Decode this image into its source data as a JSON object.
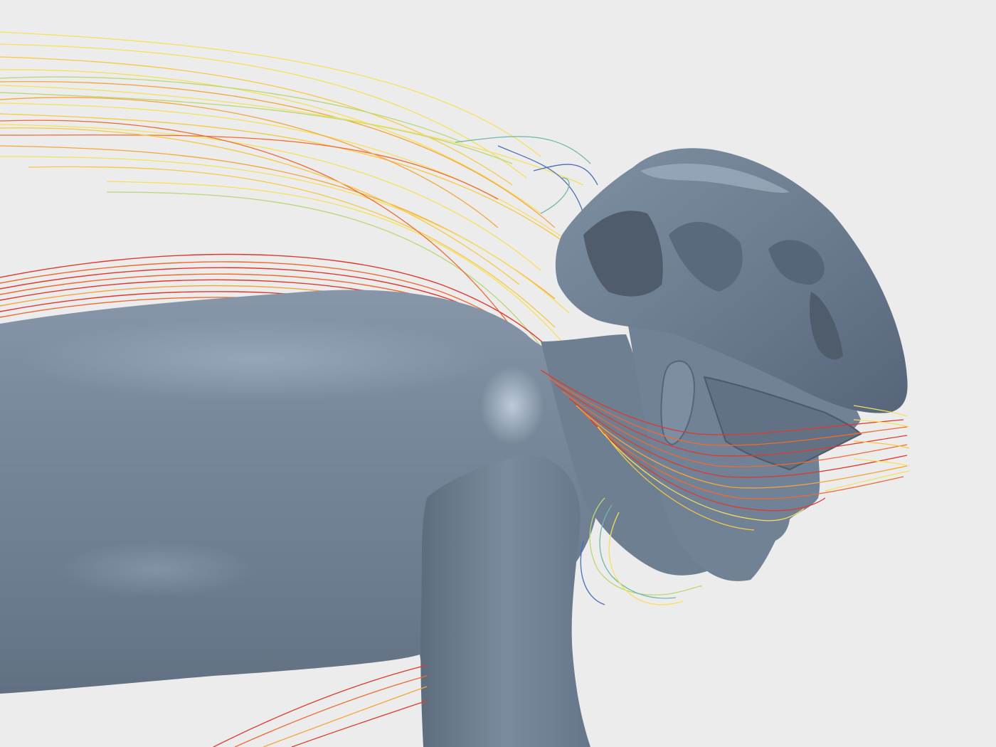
{
  "scene": {
    "background_color": "#ececec",
    "subject": "cyclist-aero-cfd-streamlines",
    "body_color": "#6f7f91",
    "body_highlight_color": "#a9bacb",
    "body_shadow_color": "#4f5d6d",
    "streamline_colors": [
      "#e0392b",
      "#f06a32",
      "#f7a43a",
      "#f5e05a",
      "#b9d774",
      "#6fb7a8",
      "#4a6fb8"
    ]
  }
}
